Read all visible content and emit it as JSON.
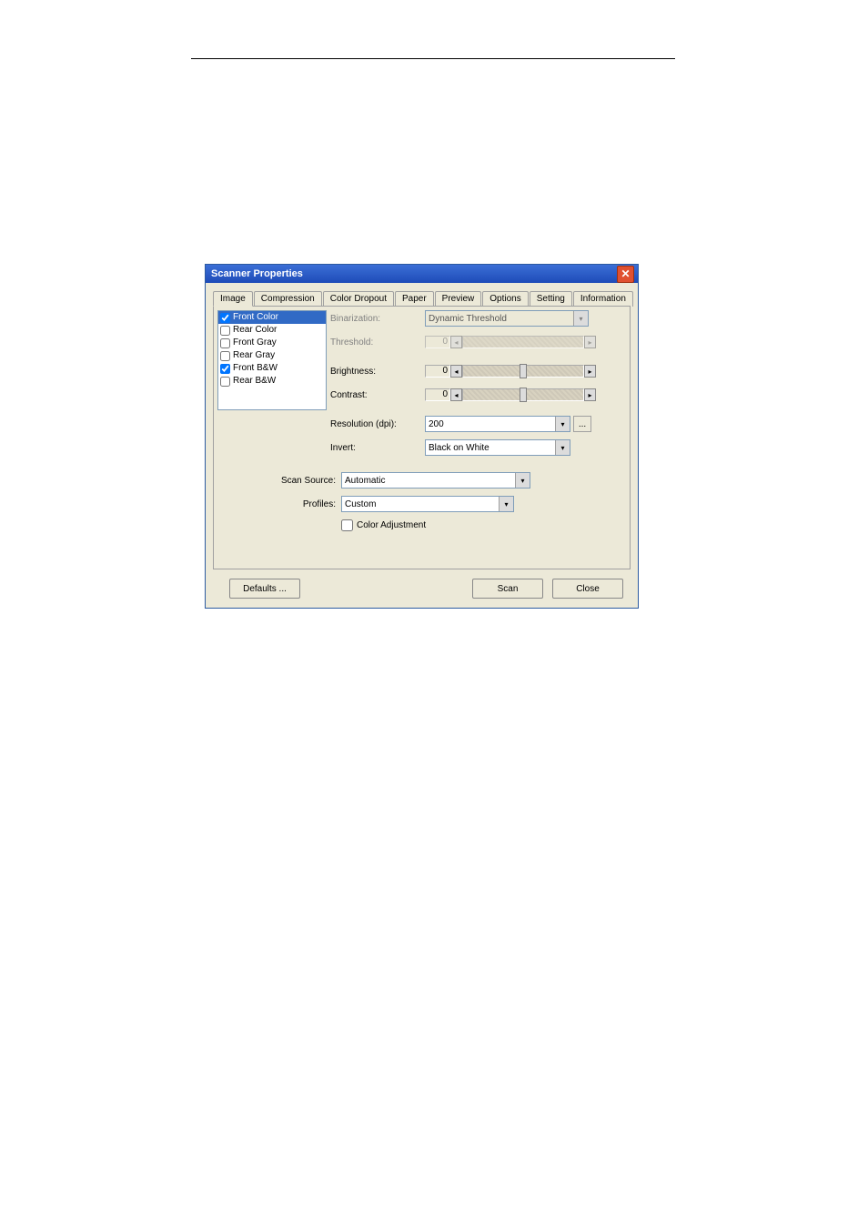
{
  "dialog": {
    "title": "Scanner Properties",
    "tabs": [
      "Image",
      "Compression",
      "Color Dropout",
      "Paper",
      "Preview",
      "Options",
      "Setting",
      "Information"
    ],
    "activeTab": 0,
    "imageList": [
      {
        "label": "Front Color",
        "checked": true,
        "selected": true
      },
      {
        "label": "Rear Color",
        "checked": false,
        "selected": false
      },
      {
        "label": "Front Gray",
        "checked": false,
        "selected": false
      },
      {
        "label": "Rear Gray",
        "checked": false,
        "selected": false
      },
      {
        "label": "Front B&W",
        "checked": true,
        "selected": false
      },
      {
        "label": "Rear B&W",
        "checked": false,
        "selected": false
      }
    ],
    "labels": {
      "binarization": "Binarization:",
      "threshold": "Threshold:",
      "brightness": "Brightness:",
      "contrast": "Contrast:",
      "resolution": "Resolution (dpi):",
      "invert": "Invert:",
      "scanSource": "Scan Source:",
      "profiles": "Profiles:",
      "colorAdjustment": "Color Adjustment"
    },
    "values": {
      "binarization": "Dynamic Threshold",
      "threshold": "0",
      "brightness": "0",
      "contrast": "0",
      "resolution": "200",
      "invert": "Black on White",
      "scanSource": "Automatic",
      "profiles": "Custom",
      "colorAdjustment": false
    },
    "buttons": {
      "defaults": "Defaults ...",
      "scan": "Scan",
      "close": "Close",
      "dots": "..."
    }
  }
}
